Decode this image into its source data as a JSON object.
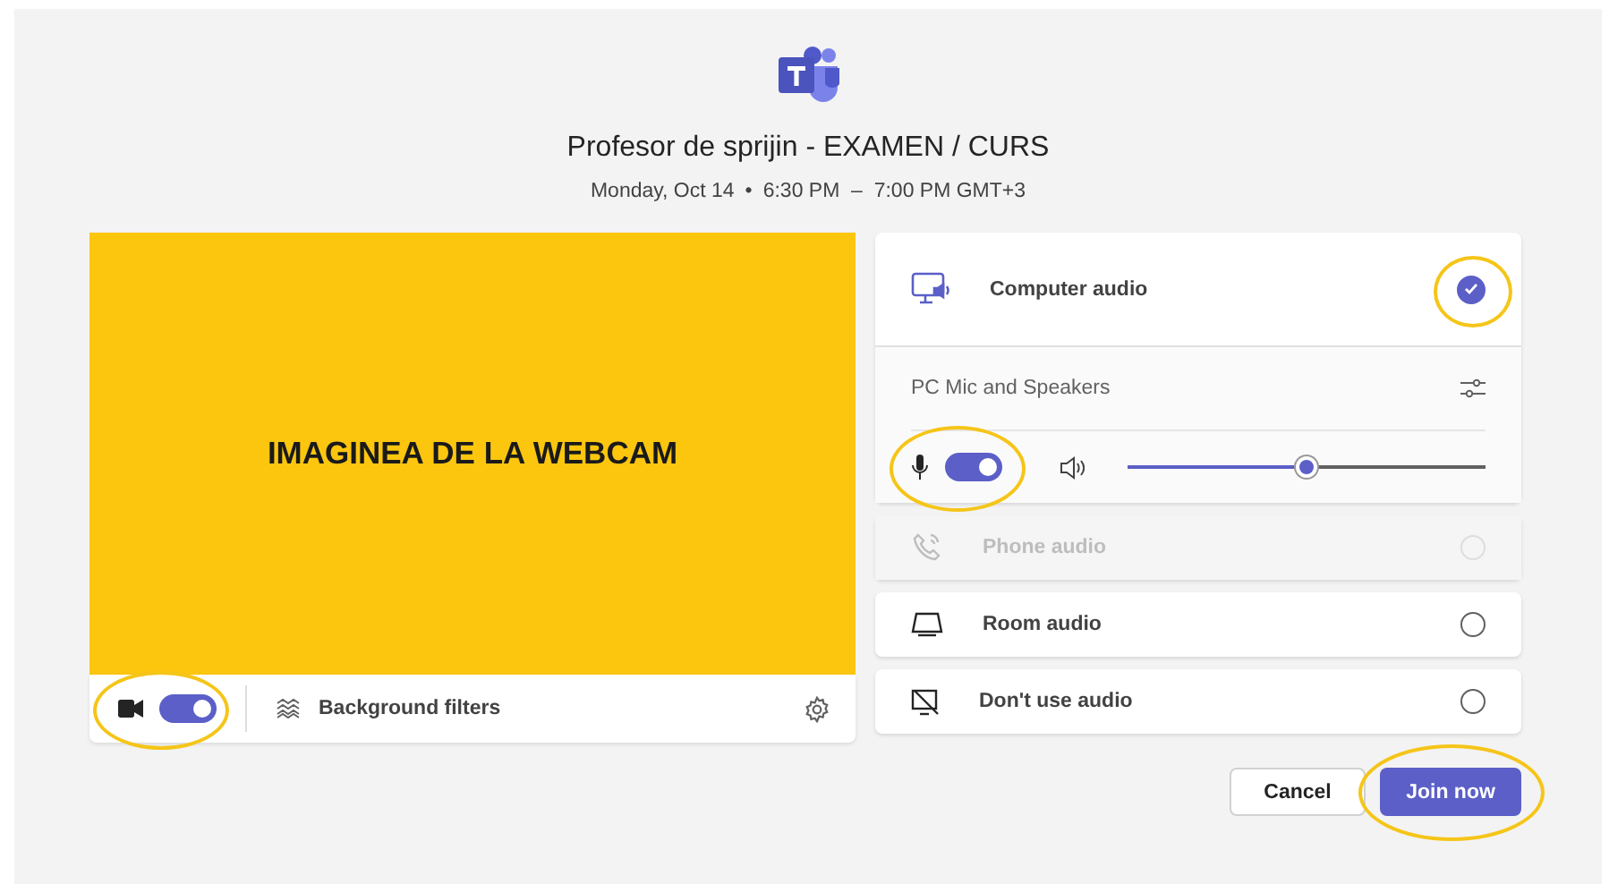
{
  "meeting": {
    "title": "Profesor de sprijin - EXAMEN / CURS",
    "date": "Monday, Oct 14",
    "separator": "•",
    "time": "6:30 PM  –  7:00 PM GMT+3"
  },
  "video": {
    "label": "IMAGINEA DE LA WEBCAM",
    "camera_on": true,
    "camera_highlighted": true,
    "filters_label": "Background filters"
  },
  "audio_options": [
    {
      "kind": "computer",
      "label": "Computer audio",
      "selected": true,
      "disabled": false,
      "highlighted": true
    },
    {
      "kind": "phone",
      "label": "Phone audio",
      "selected": false,
      "disabled": true,
      "highlighted": false
    },
    {
      "kind": "room",
      "label": "Room audio",
      "selected": false,
      "disabled": false,
      "highlighted": false
    },
    {
      "kind": "none",
      "label": "Don't use audio",
      "selected": false,
      "disabled": false,
      "highlighted": false
    }
  ],
  "device": {
    "name": "PC Mic and Speakers",
    "mic_on": true,
    "mic_highlighted": true,
    "volume": {
      "level": 0.5
    }
  },
  "buttons": [
    {
      "kind": "secondary",
      "label": "Cancel",
      "highlighted": false
    },
    {
      "kind": "primary",
      "label": "Join now",
      "highlighted": true
    }
  ]
}
